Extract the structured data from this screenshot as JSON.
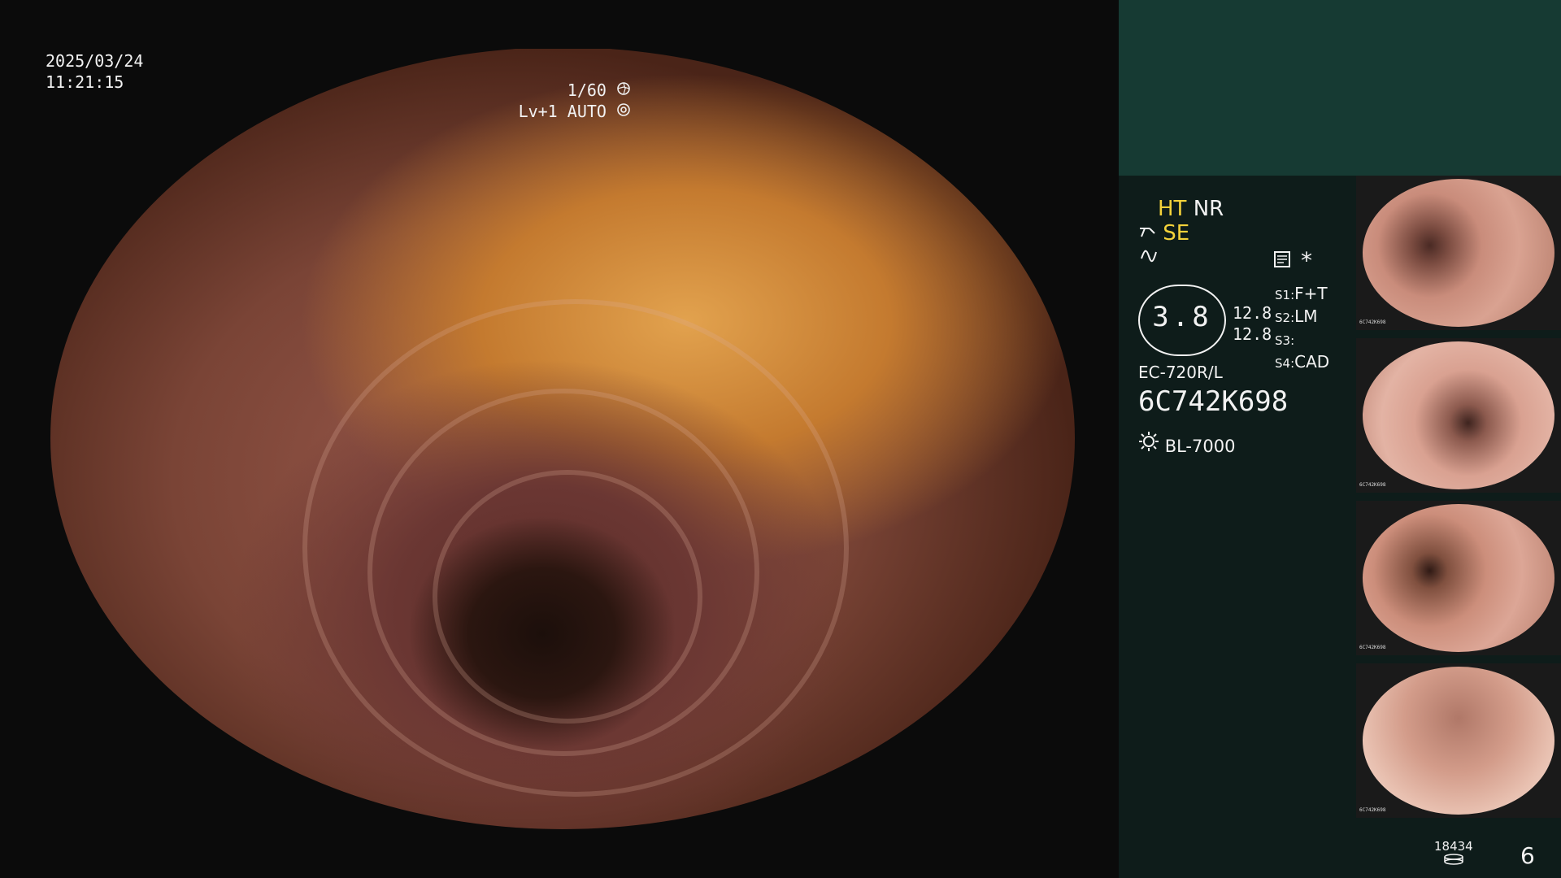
{
  "overlay": {
    "date": "2025/03/24",
    "time": "11:21:15",
    "shutter": "1/60",
    "shutter_icon": "aperture-icon",
    "level": "Lv+1",
    "mode": "AUTO",
    "mode_icon": "settings-circle-icon"
  },
  "panel": {
    "ht": "HT",
    "nr": "NR",
    "se": "SE",
    "se_icon": "scissors-icon",
    "wave_icon": "wave-icon",
    "memo_icon": "memo-icon",
    "asterisk": "*",
    "gauge_value": "3.8",
    "r1": "12.8",
    "r2": "12.8",
    "s1_label": "S1:",
    "s1_value": "F+T",
    "s2_label": "S2:",
    "s2_value": "LM",
    "s3_label": "S3:",
    "s3_value": "",
    "s4_label": "S4:",
    "s4_value": "CAD",
    "scope_model": "EC-720R/L",
    "scope_serial": "6C742K698",
    "light_source": "BL-7000",
    "light_icon": "sun-icon",
    "counter": "18434",
    "counter_icon": "cylinder-icon",
    "count": "6"
  },
  "thumbnails": [
    {
      "label": "6C742K698"
    },
    {
      "label": "6C742K698"
    },
    {
      "label": "6C742K698"
    },
    {
      "label": "6C742K698"
    }
  ]
}
